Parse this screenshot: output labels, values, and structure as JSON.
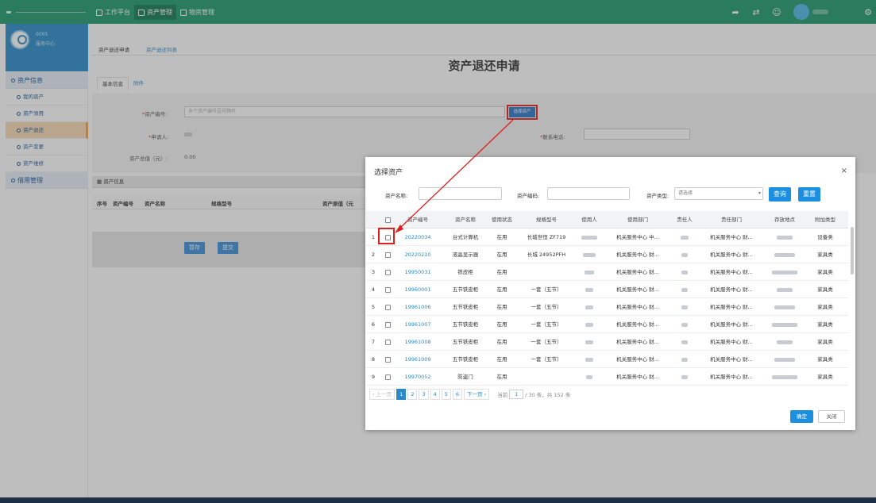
{
  "topbar": {
    "nav": [
      {
        "label": "工作平台",
        "icon": "monitor-icon",
        "active": false
      },
      {
        "label": "资产管理",
        "icon": "asset-icon",
        "active": true
      },
      {
        "label": "物资管理",
        "icon": "supplies-icon",
        "active": false
      }
    ],
    "icons": [
      "share-icon",
      "swap-icon",
      "user-icon"
    ],
    "gear": "⚙"
  },
  "sidebar": {
    "user_line1": "0005",
    "user_line2": "服务中心",
    "groups": [
      {
        "label": "资产信息",
        "items": [
          "我的资产",
          "资产领用",
          "资产退还",
          "资产变更",
          "资产维修"
        ]
      },
      {
        "label": "借用管理",
        "items": []
      }
    ],
    "active_item": "资产退还"
  },
  "tabs": [
    "资产退还申请",
    "资产退还列表"
  ],
  "page": {
    "title": "资产退还申请",
    "subtabs": [
      "基本信息",
      "附件"
    ],
    "form": {
      "asset_no_label": "资产编号:",
      "asset_no_placeholder": "多个资产编号逗号隔开",
      "select_btn": "选择资产",
      "applicant_label": "申请人:",
      "applicant_value": "",
      "phone_label": "联系电话:",
      "total_label": "资产总值（元）:",
      "total_value": "0.00"
    },
    "section": "资产信息",
    "table_headers": [
      "序号",
      "资产编号",
      "资产名称",
      "规格型号",
      "资产原值（元"
    ],
    "buttons": {
      "save": "暂存",
      "submit": "提交"
    }
  },
  "modal": {
    "title": "选择资产",
    "close": "×",
    "search": {
      "name_label": "资产名称:",
      "code_label": "资产编码:",
      "type_label": "资产类型:",
      "type_placeholder": "请选择",
      "query": "查询",
      "reset": "重置"
    },
    "columns": [
      "资产编号",
      "资产名称",
      "使用状态",
      "规格型号",
      "使用人",
      "使用部门",
      "责任人",
      "责任部门",
      "存放地点",
      "附加类型"
    ],
    "rows": [
      {
        "n": "1",
        "code": "20220034",
        "name": "台式计算机",
        "status": "在用",
        "spec": "长城世恒 ZF719",
        "dept": "机关服务中心 中...",
        "rdept": "机关服务中心 财...",
        "type": "设备类"
      },
      {
        "n": "2",
        "code": "20220210",
        "name": "液晶显示器",
        "status": "在用",
        "spec": "长城 24952PFH",
        "dept": "机关服务中心 财...",
        "rdept": "机关服务中心 财...",
        "type": "家具类"
      },
      {
        "n": "3",
        "code": "19950031",
        "name": "铁皮柜",
        "status": "在用",
        "spec": "",
        "dept": "机关服务中心 财...",
        "rdept": "机关服务中心 财...",
        "type": "家具类"
      },
      {
        "n": "4",
        "code": "19960001",
        "name": "五节铁皮柜",
        "status": "在用",
        "spec": "一套（五节）",
        "dept": "机关服务中心 财...",
        "rdept": "机关服务中心 财...",
        "type": "家具类"
      },
      {
        "n": "5",
        "code": "19961006",
        "name": "五节铁皮柜",
        "status": "在用",
        "spec": "一套（五节）",
        "dept": "机关服务中心 财...",
        "rdept": "机关服务中心 财...",
        "type": "家具类"
      },
      {
        "n": "6",
        "code": "19961007",
        "name": "五节铁皮柜",
        "status": "在用",
        "spec": "一套（五节）",
        "dept": "机关服务中心 财...",
        "rdept": "机关服务中心 财...",
        "type": "家具类"
      },
      {
        "n": "7",
        "code": "19961008",
        "name": "五节铁皮柜",
        "status": "在用",
        "spec": "一套（五节）",
        "dept": "机关服务中心 财...",
        "rdept": "机关服务中心 财...",
        "type": "家具类"
      },
      {
        "n": "8",
        "code": "19961009",
        "name": "五节铁皮柜",
        "status": "在用",
        "spec": "一套（五节）",
        "dept": "机关服务中心 财...",
        "rdept": "机关服务中心 财...",
        "type": "家具类"
      },
      {
        "n": "9",
        "code": "19970052",
        "name": "防盗门",
        "status": "在用",
        "spec": "",
        "dept": "机关服务中心 财...",
        "rdept": "机关服务中心 财...",
        "type": "家具类"
      }
    ],
    "pager": {
      "prev": "‹ 上一页",
      "pages": [
        "1",
        "2",
        "3",
        "4",
        "5",
        "6"
      ],
      "next": "下一页 ›",
      "current_label": "当前",
      "current": "1",
      "total_pages_text": "/ 30 条，共 152 条"
    },
    "ok": "确定",
    "cancel": "关闭"
  },
  "colors": {
    "topbar": "#1e9a6e",
    "accent": "#1c8fe0",
    "highlight": "#e02020"
  }
}
